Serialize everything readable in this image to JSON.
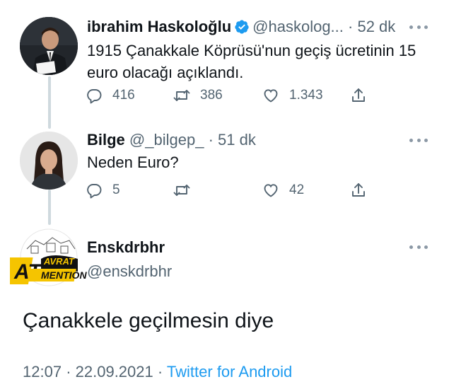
{
  "tweets": [
    {
      "name": "ibrahim Haskoloğlu",
      "handle": "@haskolog...",
      "separator": "·",
      "time": "52 dk",
      "verified": true,
      "text_line1": "1915 Çanakkale Köprüsü'nun geçiş ücretinin 15",
      "text_line2": "euro olacağı açıklandı.",
      "replies": "416",
      "retweets": "386",
      "likes": "1.343"
    },
    {
      "name": "Bilge",
      "handle": "@_bilgep_",
      "separator": "·",
      "time": "51 dk",
      "text": "Neden Euro?",
      "replies": "5",
      "retweets": "",
      "likes": "42"
    }
  ],
  "main_tweet": {
    "name": "Enskdrbhr",
    "handle": "@enskdrbhr",
    "logo_text": "AT AVRAT MENTION",
    "text": "Çanakkele geçilmesin diye",
    "time": "12:07",
    "date": "22.09.2021",
    "separator": "·",
    "source": "Twitter for Android"
  },
  "colors": {
    "verified": "#1d9bf0",
    "link": "#1d9bf0",
    "secondary": "#536471",
    "thread_line": "#cfd9de",
    "logo_yellow": "#f5c400"
  }
}
